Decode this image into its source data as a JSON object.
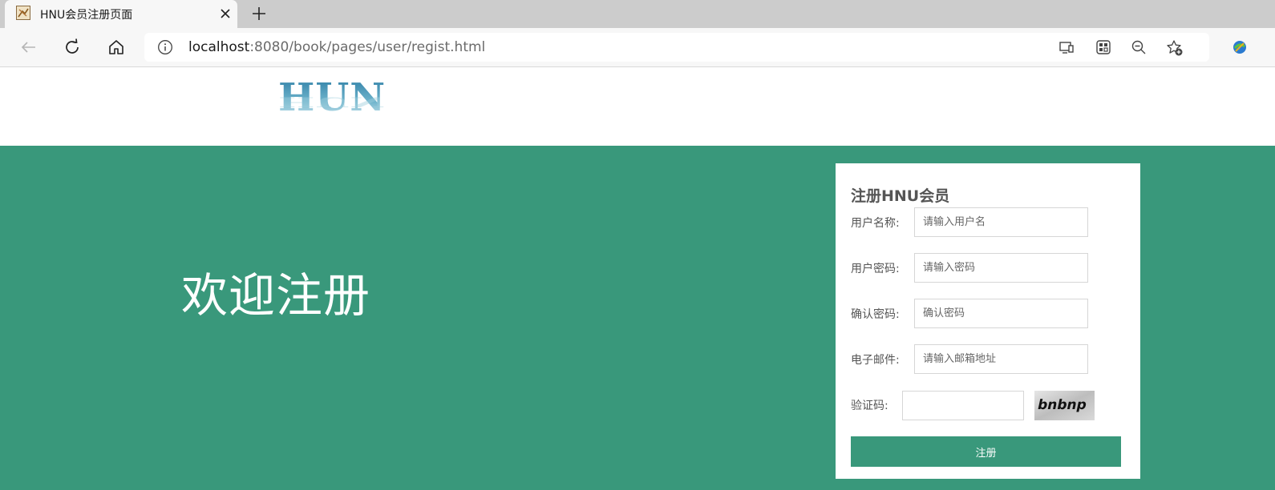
{
  "browser": {
    "tab_title": "HNU会员注册页面",
    "url_host": "localhost",
    "url_rest": ":8080/book/pages/user/regist.html",
    "icons": {
      "back": "arrow-left-icon",
      "refresh": "refresh-icon",
      "home": "home-icon",
      "info": "info-icon",
      "close": "close-icon",
      "new_tab": "plus-icon",
      "cast": "cast-icon",
      "apps": "apps-icon",
      "zoom": "zoom-out-icon",
      "favorite": "favorite-add-icon",
      "extension": "extension-icon"
    }
  },
  "header": {
    "logo_text": "HUN"
  },
  "banner": {
    "welcome": "欢迎注册",
    "background_color": "#39987b"
  },
  "form": {
    "title": "注册HNU会员",
    "username": {
      "label": "用户名称:",
      "placeholder": "请输入用户名"
    },
    "password": {
      "label": "用户密码:",
      "placeholder": "请输入密码"
    },
    "confirm": {
      "label": "确认密码:",
      "placeholder": "确认密码"
    },
    "email": {
      "label": "电子邮件:",
      "placeholder": "请输入邮箱地址"
    },
    "captcha": {
      "label": "验证码:",
      "image_text": "bnbnp"
    },
    "submit_label": "注册",
    "accent_color": "#39987b"
  }
}
